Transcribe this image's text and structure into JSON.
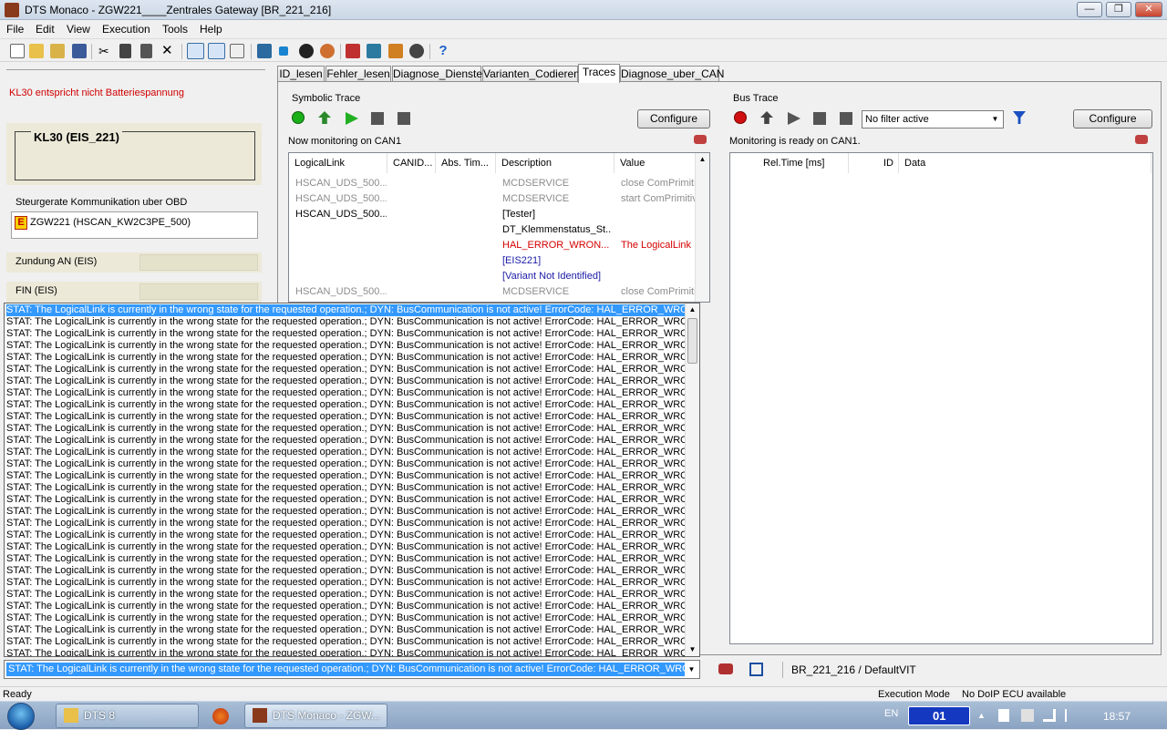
{
  "window": {
    "title": "DTS Monaco  - ZGW221____Zentrales Gateway [BR_221_216]",
    "min_label": "—",
    "max_label": "❐",
    "close_label": "✕"
  },
  "menu": [
    "File",
    "Edit",
    "View",
    "Execution",
    "Tools",
    "Help"
  ],
  "left": {
    "kl30_warning": "KL30 entspricht nicht Batteriespannung",
    "kl30_title": "KL30 (EIS_221)",
    "group_label": "Steurgerate Kommunikation uber OBD",
    "ecu_badge": "E",
    "ecu_name": "ZGW221 (HSCAN_KW2C3PE_500)",
    "row1_label": "Zundung AN (EIS)",
    "row2_label": "FIN  (EIS)"
  },
  "tabs": [
    "ID_lesen",
    "Fehler_lesen",
    "Diagnose_Dienste",
    "Varianten_Codieren",
    "Traces",
    "Diagnose_uber_CAN"
  ],
  "symbolic": {
    "section_label": "Symbolic Trace",
    "configure_label": "Configure",
    "status": "Now monitoring on CAN1",
    "columns": [
      "LogicalLink",
      "CANID...",
      "Abs. Tim...",
      "Description",
      "Value"
    ],
    "rows": [
      {
        "link": "HSCAN_UDS_500...",
        "desc": "MCDSERVICE",
        "value": "close ComPrimitiv",
        "style": "gray"
      },
      {
        "link": "HSCAN_UDS_500...",
        "desc": "MCDSERVICE",
        "value": "start ComPrimitive",
        "style": "gray"
      },
      {
        "link": "HSCAN_UDS_500...",
        "desc": "[Tester]",
        "value": "",
        "style": "black"
      },
      {
        "link": "",
        "desc": "DT_Klemmenstatus_St...",
        "value": "",
        "style": "black"
      },
      {
        "link": "",
        "desc": "HAL_ERROR_WRON...",
        "value": "The LogicalLink ...",
        "style": "red"
      },
      {
        "link": "",
        "desc": "[EIS221]",
        "value": "",
        "style": "blue"
      },
      {
        "link": "",
        "desc": "[Variant Not Identified]",
        "value": "",
        "style": "blue"
      },
      {
        "link": "HSCAN_UDS_500...",
        "desc": "MCDSERVICE",
        "value": "close ComPrimitiv",
        "style": "gray"
      }
    ]
  },
  "bus": {
    "section_label": "Bus Trace",
    "filter_value": "No filter active",
    "configure_label": "Configure",
    "status": "Monitoring is ready on CAN1.",
    "columns": [
      "Rel.Time [ms]",
      "ID",
      "Data"
    ]
  },
  "dropdown": {
    "message": "STAT: The LogicalLink is currently in the wrong state for the requested operation.; DYN: BusCommunication is not active! ErrorCode: HAL_ERROR_WRONG_",
    "row_count": 30,
    "selected_value": "STAT: The LogicalLink is currently in the wrong state for the requested operation.; DYN: BusCommunication is not active! ErrorCode: HAL_ERROR_WRONG"
  },
  "bottom": {
    "vit_label": "BR_221_216 / DefaultVIT"
  },
  "statusbar": {
    "left": "Ready",
    "mode": "Execution Mode",
    "doip": "No DoIP ECU available"
  },
  "taskbar": {
    "items": [
      "DTS 8",
      "DTS Monaco  - ZGW..."
    ],
    "lang": "EN",
    "clock": "18:57",
    "ime_label": "01"
  },
  "colors": {
    "selection": "#3399ff",
    "error_text": "#d40000",
    "info_text": "#1a1aa8",
    "panel_beige": "#ece9d8"
  },
  "toolbar_icons": [
    "new-icon",
    "open-icon",
    "open-folder-icon",
    "save-icon",
    "cut-icon",
    "copy-icon",
    "paste-icon",
    "delete-icon",
    "layout-1-icon",
    "layout-2-icon",
    "layout-3-icon",
    "connect-icon",
    "stop-icon",
    "record-icon",
    "refresh-icon",
    "settings-icon",
    "network-icon",
    "ecu-icon",
    "tool-icon",
    "help-icon"
  ]
}
